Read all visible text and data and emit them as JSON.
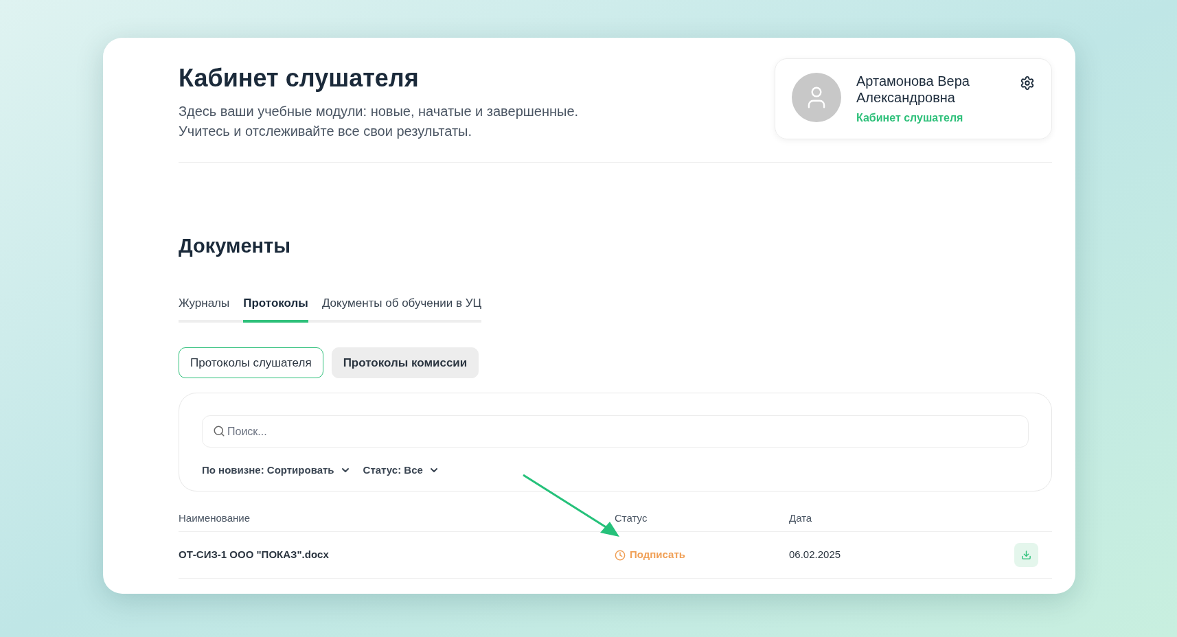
{
  "header": {
    "title": "Кабинет слушателя",
    "subtitle_lines": [
      "Здесь ваши учебные модули: новые, начатые и завершенные.",
      "Учитесь и отслеживайте все свои результаты."
    ]
  },
  "profile": {
    "name_lines": [
      "Артамонова Вера",
      "Александровна"
    ],
    "role": "Кабинет слушателя"
  },
  "documents": {
    "title": "Документы",
    "tabs": [
      {
        "label": "Журналы",
        "selected": false
      },
      {
        "label": "Протоколы",
        "selected": true
      },
      {
        "label": "Документы об обучении в УЦ",
        "selected": false
      }
    ],
    "subtabs": [
      {
        "label": "Протоколы слушателя",
        "selected": true
      },
      {
        "label": "Протоколы комиссии",
        "selected": false
      }
    ],
    "search": {
      "placeholder": "Поиск..."
    },
    "filters": [
      {
        "label": "По новизне: Сортировать"
      },
      {
        "label": "Статус: Все"
      }
    ],
    "table": {
      "columns": [
        "Наименование",
        "Статус",
        "Дата"
      ],
      "rows": [
        {
          "name": "ОТ-СИЗ-1 ООО \"ПОКАЗ\".docx",
          "status": "Подписать",
          "kind": "pending",
          "date": "06.02.2025"
        }
      ]
    }
  }
}
